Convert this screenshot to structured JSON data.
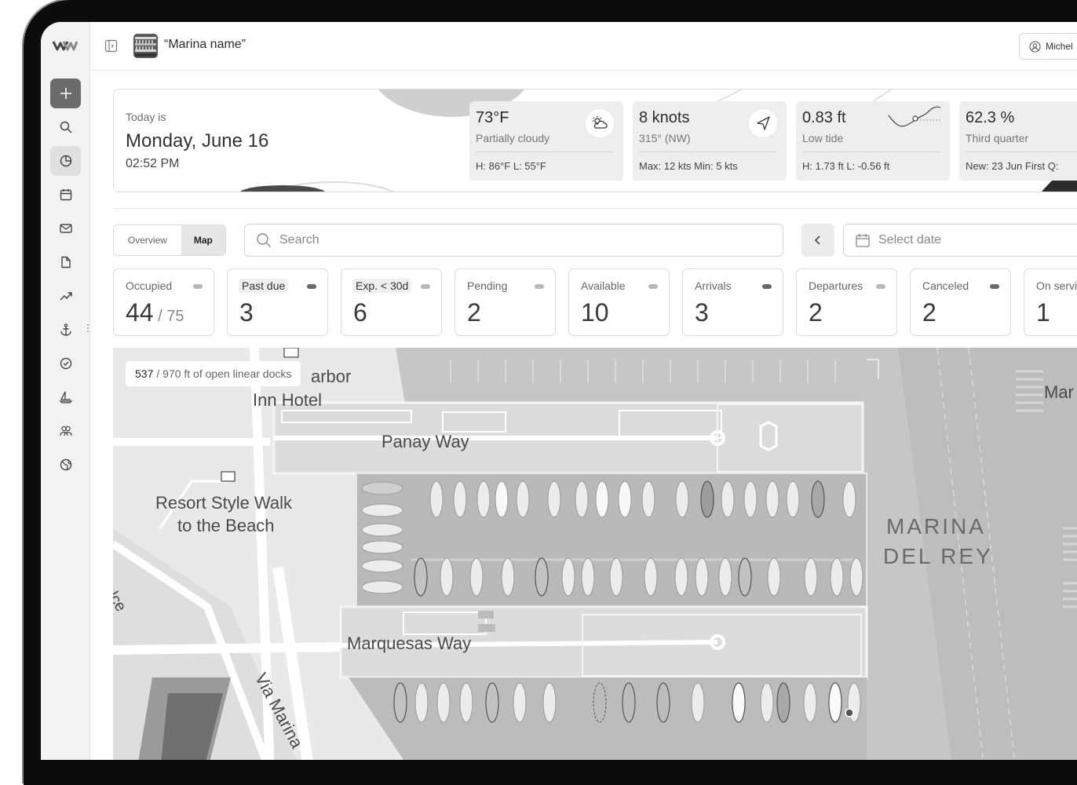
{
  "header": {
    "marina_name": "“Marina name”",
    "user_name": "Michel"
  },
  "today": {
    "label": "Today is",
    "date": "Monday, June 16",
    "time": "02:52 PM"
  },
  "metrics": {
    "weather": {
      "value": "73°F",
      "sub": "Partially cloudy",
      "foot": "H: 86°F   L: 55°F",
      "icon": "cloud-sun-icon"
    },
    "wind": {
      "value": "8 knots",
      "sub": "315° (NW)",
      "foot": "Max: 12 kts   Min: 5 kts",
      "icon": "wind-direction-icon"
    },
    "tide": {
      "value": "0.83 ft",
      "sub": "Low tide",
      "foot": "H: 1.73 ft   L: -0.56 ft",
      "icon": "tide-chart-icon"
    },
    "moon": {
      "value": "62.3 %",
      "sub": "Third quarter",
      "foot": "New: 23 Jun   First Q:",
      "icon": "moon-icon"
    }
  },
  "controls": {
    "overview_label": "Overview",
    "map_label": "Map",
    "search_placeholder": "Search",
    "date_placeholder": "Select date"
  },
  "stats": [
    {
      "label": "Occupied",
      "value": "44",
      "total": " / 75"
    },
    {
      "label": "Past due",
      "value": "3"
    },
    {
      "label": "Exp. < 30d",
      "value": "6"
    },
    {
      "label": "Pending",
      "value": "2"
    },
    {
      "label": "Available",
      "value": "10"
    },
    {
      "label": "Arrivals",
      "value": "3"
    },
    {
      "label": "Departures",
      "value": "2"
    },
    {
      "label": "Canceled",
      "value": "2"
    },
    {
      "label": "On servi",
      "value": "1"
    }
  ],
  "map": {
    "docks_open": "537",
    "docks_total": " / 970 ft of open linear docks",
    "labels": {
      "harbor": "arbor",
      "inn_hotel": "Inn Hotel",
      "panay": "Panay Way",
      "resort_1": "Resort Style Walk",
      "resort_2": "to the Beach",
      "dolce": "Dolce",
      "marquesas": "Marquesas Way",
      "via_marina": "Via Marina",
      "marina_del_rey_1": "MARINA",
      "marina_del_rey_2": "DEL REY",
      "mar": "Mar"
    }
  },
  "colors": {
    "accent": "#6b6b6b",
    "water": "#c4c4c4",
    "land": "#e9e9e9",
    "dock": "#d2d2d2"
  }
}
